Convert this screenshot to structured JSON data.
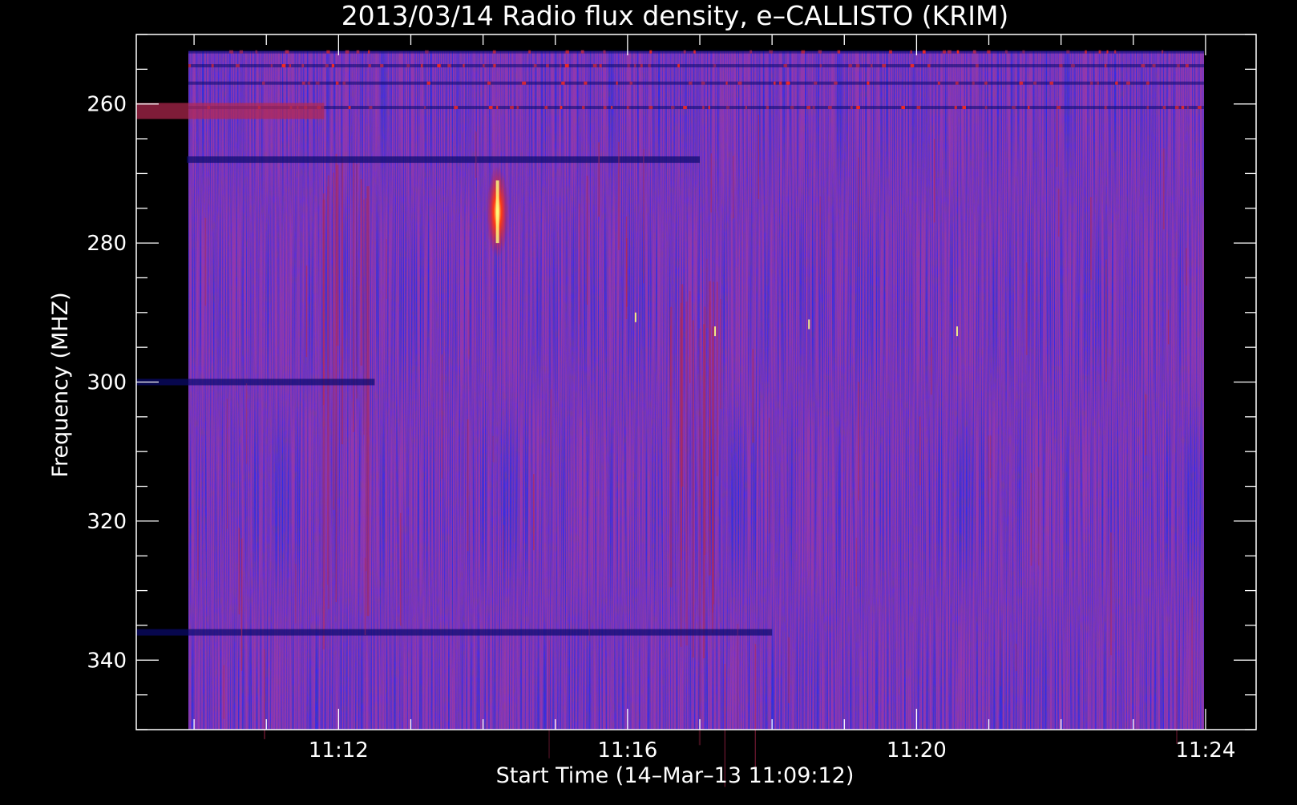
{
  "chart_data": {
    "type": "heatmap",
    "title": "2013/03/14  Radio flux density, e–CALLISTO (KRIM)",
    "xlabel": "Start Time (14–Mar–13 11:09:12)",
    "ylabel": "Frequency (MHZ)",
    "x_axis": {
      "min": "11:09:12",
      "max": "11:24:42",
      "range_minutes_from_11_00": [
        9.2,
        24.7
      ],
      "major_ticks": [
        {
          "label": "11:12",
          "value": 12
        },
        {
          "label": "11:16",
          "value": 16
        },
        {
          "label": "11:20",
          "value": 20
        },
        {
          "label": "11:24",
          "value": 24
        }
      ],
      "minor_tick_interval_minutes": 1
    },
    "y_axis": {
      "min": 250,
      "max": 350,
      "inverted": true,
      "major_ticks": [
        {
          "label": "260",
          "value": 260
        },
        {
          "label": "280",
          "value": 280
        },
        {
          "label": "300",
          "value": 300
        },
        {
          "label": "320",
          "value": 320
        },
        {
          "label": "340",
          "value": 340
        }
      ],
      "minor_tick_interval": 5
    },
    "colormap": [
      "#0a0a6e",
      "#1e1ed2",
      "#2a2af5",
      "#b42850",
      "#ff2a1a",
      "#ffff80"
    ],
    "background": "#000000",
    "axis_color": "#ffffff",
    "data_extent": {
      "time_start": 9.2,
      "time_end": 24.7,
      "freq_start": 250,
      "freq_end": 350
    },
    "features": [
      {
        "kind": "bright_burst",
        "time": 14.2,
        "freq_range": [
          271,
          280
        ],
        "intensity": 1.0
      },
      {
        "kind": "vertical_streak",
        "time": 12.1,
        "freq_range": [
          265,
          330
        ],
        "intensity": 0.6
      },
      {
        "kind": "vertical_streak",
        "time": 16.9,
        "freq_range": [
          285,
          345
        ],
        "intensity": 0.6
      },
      {
        "kind": "horizontal_band",
        "freq": 261,
        "time_range": [
          9.2,
          11.8
        ],
        "intensity": 0.7
      },
      {
        "kind": "dark_band",
        "freq": 268,
        "time_range": [
          9.9,
          17.0
        ]
      },
      {
        "kind": "dark_band",
        "freq": 300,
        "time_range": [
          9.2,
          12.5
        ]
      },
      {
        "kind": "dark_band",
        "freq": 336,
        "time_range": [
          9.2,
          18.0
        ]
      }
    ]
  }
}
